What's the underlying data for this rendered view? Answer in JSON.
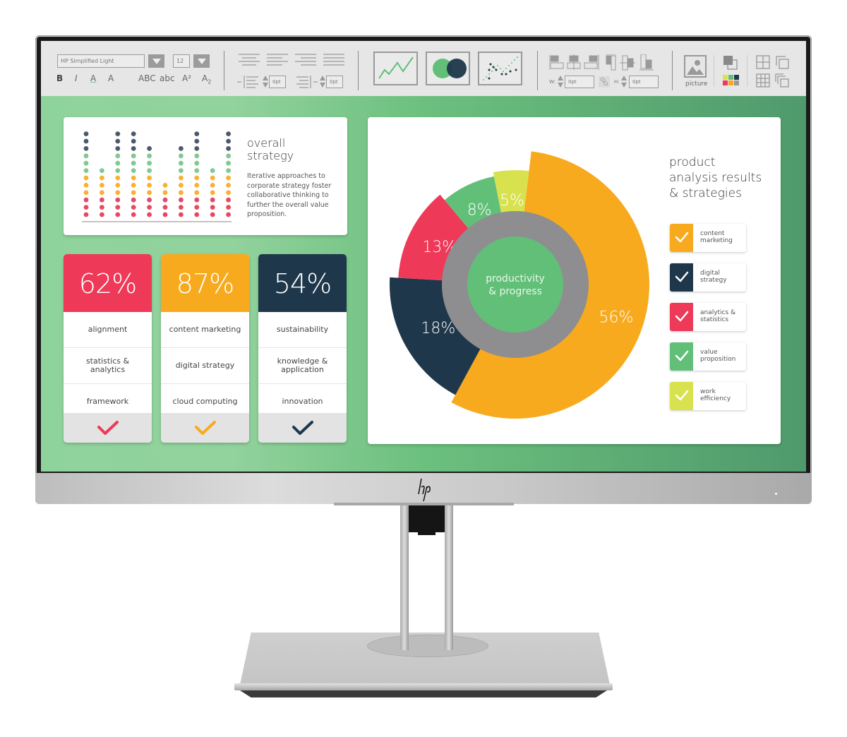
{
  "toolbar": {
    "font_name": "HP Simplified Light",
    "font_size": "12",
    "bold": "B",
    "italic": "I",
    "underline_a": "A",
    "outline_a": "A",
    "uppercase": "ABC",
    "lowercase": "abc",
    "superscript": "A²",
    "subscript_base": "A",
    "subscript_mark": "2",
    "indent_left_value": "0pt",
    "indent_right_value": "0pt",
    "width_label": "W:",
    "width_value": "0pt",
    "height_label": "H:",
    "height_value": "0pt",
    "picture_label": "picture"
  },
  "overall_strategy": {
    "title_line1": "overall",
    "title_line2": "strategy",
    "description": "Iterative approaches to corporate strategy foster collaborative thinking to further the overall value proposition.",
    "dot_columns": [
      12,
      7,
      12,
      12,
      10,
      5,
      10,
      12,
      7,
      12
    ],
    "dot_colors": [
      "#e84864",
      "#e84864",
      "#e84864",
      "#f8b133",
      "#f8b133",
      "#f8b133",
      "#7fca91",
      "#7fca91",
      "#7fca91",
      "#4a5a68",
      "#4a5a68",
      "#4a5a68"
    ]
  },
  "stat_cards": [
    {
      "value": "62%",
      "color": "#ee3958",
      "rows": [
        "alignment",
        "statistics & analytics",
        "framework"
      ]
    },
    {
      "value": "87%",
      "color": "#f8aa1e",
      "rows": [
        "content marketing",
        "digital strategy",
        "cloud computing"
      ]
    },
    {
      "value": "54%",
      "color": "#1f374b",
      "rows": [
        "sustainability",
        "knowledge & application",
        "innovation"
      ]
    }
  ],
  "product_analysis": {
    "title_line1": "product",
    "title_line2": "analysis results",
    "title_line3": "& strategies",
    "center_line1": "productivity",
    "center_line2": "& progress",
    "legend": [
      {
        "label_line1": "content",
        "label_line2": "marketing",
        "color": "#f8aa1e"
      },
      {
        "label_line1": "digital",
        "label_line2": "strategy",
        "color": "#1f374b"
      },
      {
        "label_line1": "analytics &",
        "label_line2": "statistics",
        "color": "#ee3958"
      },
      {
        "label_line1": "value",
        "label_line2": "proposition",
        "color": "#62bf78"
      },
      {
        "label_line1": "work",
        "label_line2": "efficiency",
        "color": "#d8e24f"
      }
    ]
  },
  "chart_data": {
    "type": "pie",
    "title": "product analysis results & strategies",
    "center_label": "productivity & progress",
    "categories": [
      "content marketing",
      "digital strategy",
      "analytics & statistics",
      "value proposition",
      "work efficiency"
    ],
    "values": [
      56,
      18,
      13,
      8,
      5
    ],
    "labels": [
      "56%",
      "18%",
      "13%",
      "8%",
      "5%"
    ],
    "colors": [
      "#f8aa1e",
      "#1f374b",
      "#ee3958",
      "#62bf78",
      "#d8e24f"
    ],
    "legend_position": "right"
  },
  "brand": {
    "logo_text": "hp"
  }
}
